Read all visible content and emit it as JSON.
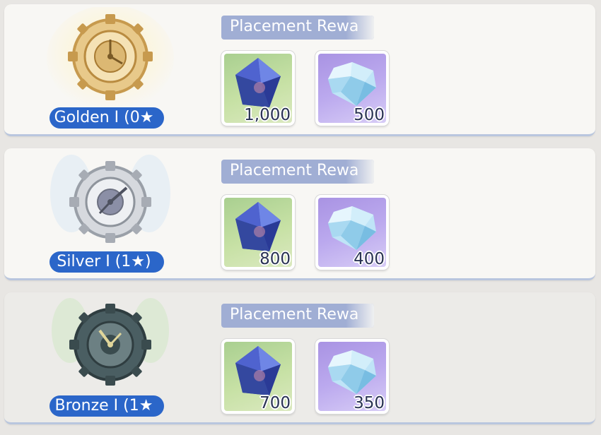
{
  "tiers": [
    {
      "rank": "Golden I (0★",
      "rewards_title": "Placement Rewa",
      "rewards": [
        {
          "icon": "crystal-cube-icon",
          "quantity": "1,000"
        },
        {
          "icon": "diamond-gem-icon",
          "quantity": "500"
        }
      ]
    },
    {
      "rank": "Silver I (1★)",
      "rewards_title": "Placement Rewa",
      "rewards": [
        {
          "icon": "crystal-cube-icon",
          "quantity": "800"
        },
        {
          "icon": "diamond-gem-icon",
          "quantity": "400"
        }
      ]
    },
    {
      "rank": "Bronze I (1★",
      "rewards_title": "Placement Rewa",
      "rewards": [
        {
          "icon": "crystal-cube-icon",
          "quantity": "700"
        },
        {
          "icon": "diamond-gem-icon",
          "quantity": "350"
        }
      ]
    }
  ],
  "colors": {
    "gold": "#d9b56a",
    "silver": "#bfc3ca",
    "bronze": "#3f5256",
    "rank_pill": "#2b66c9",
    "title_bar": "#a0aed4"
  }
}
